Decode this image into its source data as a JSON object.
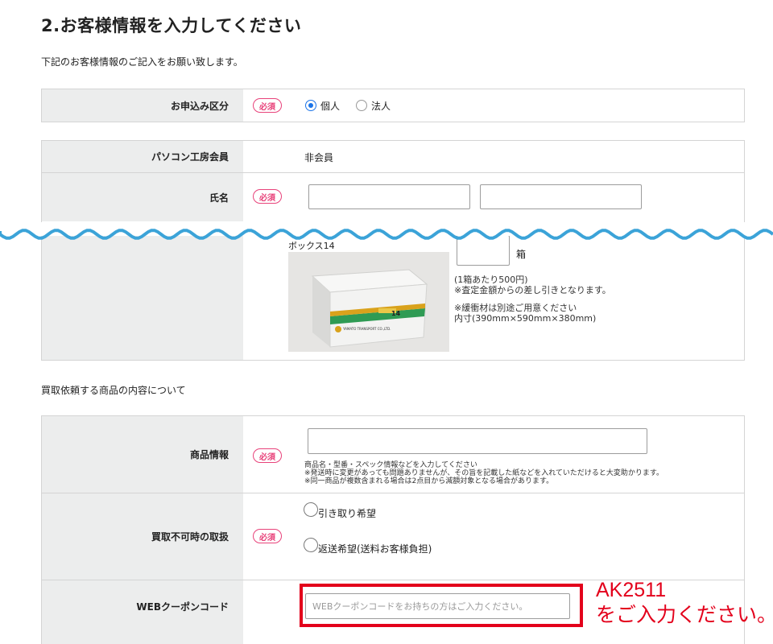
{
  "page": {
    "title": "2.お客様情報を入力してください",
    "intro": "下記のお客様情報のご記入をお願い致します。"
  },
  "required_badge": "必須",
  "application_type": {
    "label": "お申込み区分",
    "options": [
      "個人",
      "法人"
    ],
    "selected": "個人"
  },
  "membership": {
    "label": "パソコン工房会員",
    "value": "非会員"
  },
  "name": {
    "label": "氏名",
    "last_name_value": "",
    "first_name_value": ""
  },
  "box": {
    "product_name": "ボックス14",
    "quantity_value": "",
    "unit": "箱",
    "notes": [
      "(1箱あたり500円)",
      "※査定金額からの差し引きとなります。",
      "",
      "※緩衝材は別途ご用意ください",
      "内寸(390mm×590mm×380mm)"
    ],
    "photo_label": "14",
    "photo_brand": "YAMATO TRANSPORT CO.,LTD."
  },
  "items_section": {
    "heading": "買取依頼する商品の内容について"
  },
  "product_info": {
    "label": "商品情報",
    "value": "",
    "notes": [
      "商品名・型番・スペック情報などを入力してください",
      "※発送時に変更があっても問題ありませんが、その旨を記載した紙などを入れていただけると大変助かります。",
      "※同一商品が複数含まれる場合は2点目から減額対象となる場合があります。"
    ]
  },
  "unpurchasable": {
    "label": "買取不可時の取扱",
    "options": [
      "引き取り希望",
      "返送希望(送料お客様負担)"
    ]
  },
  "coupon": {
    "label": "WEBクーポンコード",
    "placeholder": "WEBクーポンコードをお持ちの方はご入力ください。",
    "value": "",
    "callout_code": "AK2511",
    "callout_text": "をご入力ください。"
  },
  "colors": {
    "accent_red": "#e3001b",
    "required_pink": "#e8427a",
    "wave_blue": "#3ba3d8",
    "header_gray": "#eceded"
  }
}
